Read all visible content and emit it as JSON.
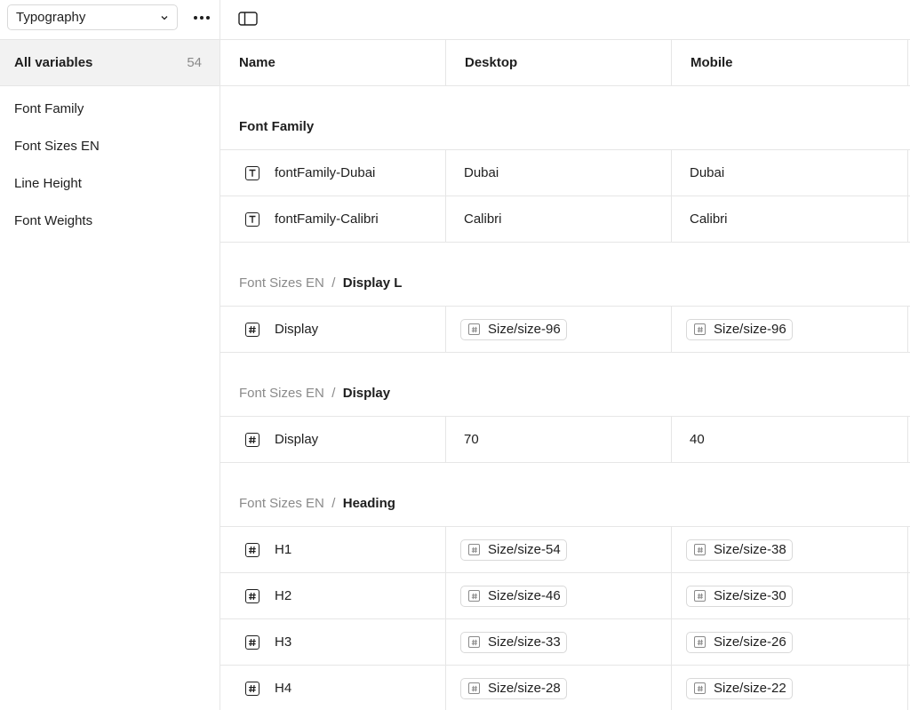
{
  "sidebar": {
    "collection": "Typography",
    "all_variables_label": "All variables",
    "all_variables_count": "54",
    "groups": [
      "Font Family",
      "Font Sizes EN",
      "Line Height",
      "Font Weights"
    ]
  },
  "table": {
    "headers": {
      "name": "Name",
      "desktop": "Desktop",
      "mobile": "Mobile"
    },
    "sections": {
      "font_family": {
        "prefix": "",
        "name": "Font Family",
        "rows": [
          {
            "icon": "text-type-icon",
            "name": "fontFamily-Dubai",
            "desktop": "Dubai",
            "mobile": "Dubai"
          },
          {
            "icon": "text-type-icon",
            "name": "fontFamily-Calibri",
            "desktop": "Calibri",
            "mobile": "Calibri"
          }
        ]
      },
      "display_l": {
        "prefix": "Font Sizes EN",
        "name": "Display L",
        "rows": [
          {
            "icon": "number-type-icon",
            "name": "Display",
            "desktop_alias": "Size/size-96",
            "mobile_alias": "Size/size-96"
          }
        ]
      },
      "display": {
        "prefix": "Font Sizes EN",
        "name": "Display",
        "rows": [
          {
            "icon": "number-type-icon",
            "name": "Display",
            "desktop": "70",
            "mobile": "40"
          }
        ]
      },
      "heading": {
        "prefix": "Font Sizes EN",
        "name": "Heading",
        "rows": [
          {
            "icon": "number-type-icon",
            "name": "H1",
            "desktop_alias": "Size/size-54",
            "mobile_alias": "Size/size-38"
          },
          {
            "icon": "number-type-icon",
            "name": "H2",
            "desktop_alias": "Size/size-46",
            "mobile_alias": "Size/size-30"
          },
          {
            "icon": "number-type-icon",
            "name": "H3",
            "desktop_alias": "Size/size-33",
            "mobile_alias": "Size/size-26"
          },
          {
            "icon": "number-type-icon",
            "name": "H4",
            "desktop_alias": "Size/size-28",
            "mobile_alias": "Size/size-22"
          }
        ]
      }
    },
    "separator": "/"
  },
  "icons": {
    "collection_dropdown": "chevron-down-icon",
    "more": "more-horizontal-icon",
    "panel_toggle": "sidebar-toggle-icon"
  }
}
